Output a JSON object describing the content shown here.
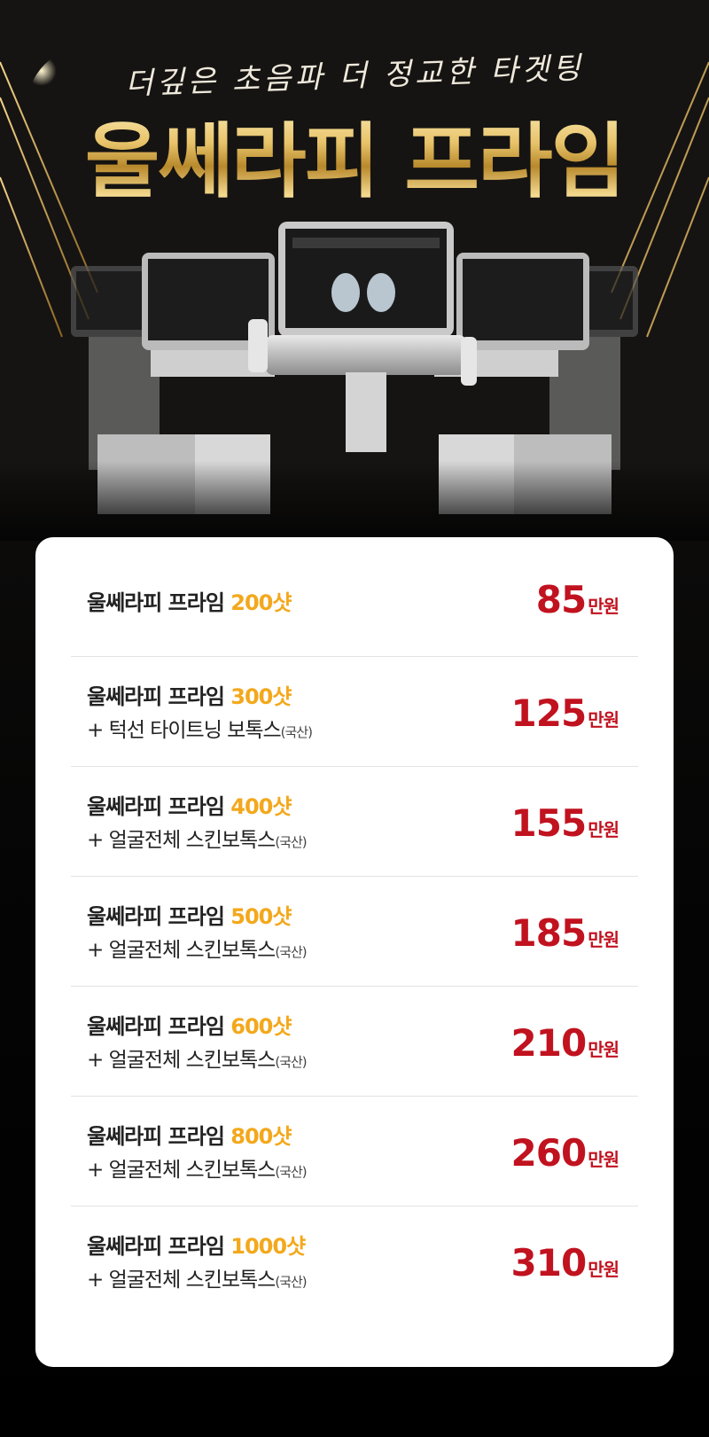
{
  "hero": {
    "subtitle": "더깊은 초음파 더 정교한 타겟팅",
    "title": "울쎄라피 프라임"
  },
  "price_list": [
    {
      "name": "울쎄라피 프라임",
      "shots": "200샷",
      "extra": "",
      "extra_note": "",
      "price": "85",
      "unit": "만원"
    },
    {
      "name": "울쎄라피 프라임",
      "shots": "300샷",
      "extra": "+ 턱선 타이트닝 보톡스",
      "extra_note": "(국산)",
      "price": "125",
      "unit": "만원"
    },
    {
      "name": "울쎄라피 프라임",
      "shots": "400샷",
      "extra": "+ 얼굴전체 스킨보톡스",
      "extra_note": "(국산)",
      "price": "155",
      "unit": "만원"
    },
    {
      "name": "울쎄라피 프라임",
      "shots": "500샷",
      "extra": "+ 얼굴전체 스킨보톡스",
      "extra_note": "(국산)",
      "price": "185",
      "unit": "만원"
    },
    {
      "name": "울쎄라피 프라임",
      "shots": "600샷",
      "extra": "+ 얼굴전체 스킨보톡스",
      "extra_note": "(국산)",
      "price": "210",
      "unit": "만원"
    },
    {
      "name": "울쎄라피 프라임",
      "shots": "800샷",
      "extra": "+ 얼굴전체 스킨보톡스",
      "extra_note": "(국산)",
      "price": "260",
      "unit": "만원"
    },
    {
      "name": "울쎄라피 프라임",
      "shots": "1000샷",
      "extra": "+ 얼굴전체 스킨보톡스",
      "extra_note": "(국산)",
      "price": "310",
      "unit": "만원"
    }
  ],
  "colors": {
    "shot_accent": "#f3a81c",
    "price_red": "#c1121f",
    "gold": "#d9b45a"
  }
}
